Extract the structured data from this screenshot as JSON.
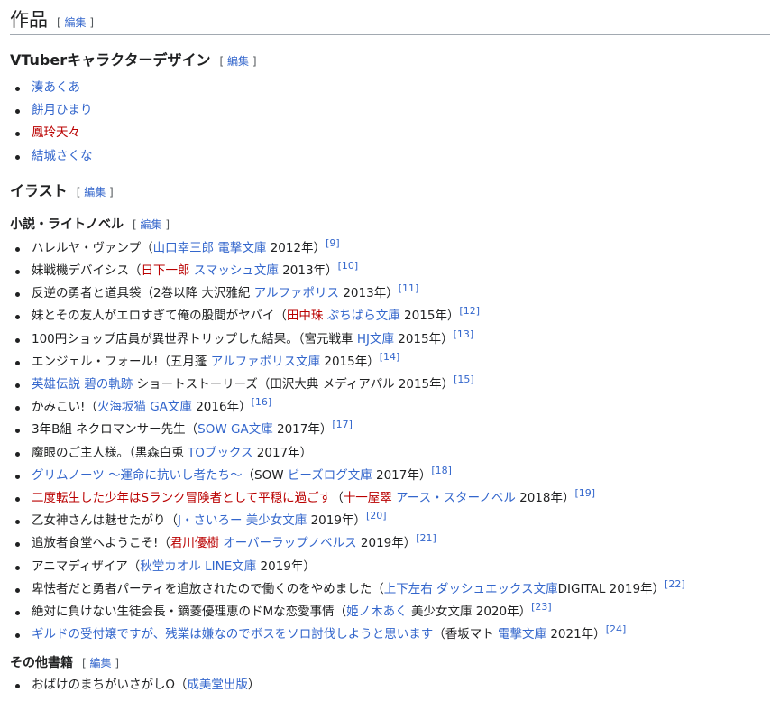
{
  "section_title": "作品",
  "edit_label": "編集",
  "vtuber": {
    "title": "VTuberキャラクターデザイン",
    "items": [
      "湊あくあ",
      "餅月ひまり",
      "鳳玲天々",
      "結城さくな"
    ]
  },
  "illust": {
    "title": "イラスト",
    "novel": {
      "title": "小説・ライトノベル"
    },
    "other": {
      "title": "その他書籍"
    }
  },
  "novels": [
    [
      [
        "ハレルヤ・ヴァンプ（",
        ""
      ],
      [
        "山口幸三郎",
        "b"
      ],
      [
        " ",
        ""
      ],
      [
        "電撃文庫",
        "b"
      ],
      [
        " 2012年）",
        ""
      ],
      [
        "[9]",
        "s"
      ]
    ],
    [
      [
        "妹戦機デバイシス（",
        ""
      ],
      [
        "日下一郎",
        "r"
      ],
      [
        " ",
        ""
      ],
      [
        "スマッシュ文庫",
        "b"
      ],
      [
        " 2013年）",
        ""
      ],
      [
        "[10]",
        "s"
      ]
    ],
    [
      [
        "反逆の勇者と道具袋（2巻以降 大沢雅紀 ",
        ""
      ],
      [
        "アルファポリス",
        "b"
      ],
      [
        " 2013年）",
        ""
      ],
      [
        "[11]",
        "s"
      ]
    ],
    [
      [
        "妹とその友人がエロすぎて俺の股間がヤバイ（",
        ""
      ],
      [
        "田中珠",
        "r"
      ],
      [
        " ",
        ""
      ],
      [
        "ぷちぱら文庫",
        "b"
      ],
      [
        " 2015年）",
        ""
      ],
      [
        "[12]",
        "s"
      ]
    ],
    [
      [
        "100円ショップ店員が異世界トリップした結果。（宮元戦車 ",
        ""
      ],
      [
        "HJ文庫",
        "b"
      ],
      [
        " 2015年）",
        ""
      ],
      [
        "[13]",
        "s"
      ]
    ],
    [
      [
        "エンジェル・フォール!（五月蓬 ",
        ""
      ],
      [
        "アルファポリス文庫",
        "b"
      ],
      [
        " 2015年）",
        ""
      ],
      [
        "[14]",
        "s"
      ]
    ],
    [
      [
        "英雄伝説 碧の軌跡",
        "b"
      ],
      [
        " ショートストーリーズ（田沢大典 メディアパル 2015年）",
        ""
      ],
      [
        "[15]",
        "s"
      ]
    ],
    [
      [
        "かみこい!（",
        ""
      ],
      [
        "火海坂猫",
        "b"
      ],
      [
        " ",
        ""
      ],
      [
        "GA文庫",
        "b"
      ],
      [
        " 2016年）",
        ""
      ],
      [
        "[16]",
        "s"
      ]
    ],
    [
      [
        "3年B組 ネクロマンサー先生（",
        ""
      ],
      [
        "SOW",
        "b"
      ],
      [
        " ",
        ""
      ],
      [
        "GA文庫",
        "b"
      ],
      [
        " 2017年）",
        ""
      ],
      [
        "[17]",
        "s"
      ]
    ],
    [
      [
        "魔眼のご主人様。（黒森白兎 ",
        ""
      ],
      [
        "TOブックス",
        "b"
      ],
      [
        " 2017年）",
        ""
      ]
    ],
    [
      [
        "グリムノーツ 〜運命に抗いし者たち〜",
        "b"
      ],
      [
        "（SOW ",
        ""
      ],
      [
        "ビーズログ文庫",
        "b"
      ],
      [
        " 2017年）",
        ""
      ],
      [
        "[18]",
        "s"
      ]
    ],
    [
      [
        "二度転生した少年はSランク冒険者として平穏に過ごす",
        "r"
      ],
      [
        "（",
        ""
      ],
      [
        "十一屋翠",
        "r"
      ],
      [
        " ",
        ""
      ],
      [
        "アース・スターノベル",
        "b"
      ],
      [
        " 2018年）",
        ""
      ],
      [
        "[19]",
        "s"
      ]
    ],
    [
      [
        "乙女神さんは魅せたがり（",
        ""
      ],
      [
        "J・さいろー",
        "b"
      ],
      [
        " ",
        ""
      ],
      [
        "美少女文庫",
        "b"
      ],
      [
        " 2019年）",
        ""
      ],
      [
        "[20]",
        "s"
      ]
    ],
    [
      [
        "追放者食堂へようこそ!（",
        ""
      ],
      [
        "君川優樹",
        "r"
      ],
      [
        " ",
        ""
      ],
      [
        "オーバーラップノベルス",
        "b"
      ],
      [
        " 2019年）",
        ""
      ],
      [
        "[21]",
        "s"
      ]
    ],
    [
      [
        "アニマディザイア（",
        ""
      ],
      [
        "秋堂カオル",
        "b"
      ],
      [
        " ",
        ""
      ],
      [
        "LINE文庫",
        "b"
      ],
      [
        " 2019年）",
        ""
      ]
    ],
    [
      [
        "卑怯者だと勇者パーティを追放されたので働くのをやめました（",
        ""
      ],
      [
        "上下左右",
        "b"
      ],
      [
        " ",
        ""
      ],
      [
        "ダッシュエックス文庫",
        "b"
      ],
      [
        "DIGITAL 2019年）",
        ""
      ],
      [
        "[22]",
        "s"
      ]
    ],
    [
      [
        "絶対に負けない生徒会長・鏑菱優理恵のドMな恋愛事情（",
        ""
      ],
      [
        "姫ノ木あく",
        "b"
      ],
      [
        " 美少女文庫 2020年）",
        ""
      ],
      [
        "[23]",
        "s"
      ]
    ],
    [
      [
        "ギルドの受付嬢ですが、残業は嫌なのでボスをソロ討伐しようと思います",
        "b"
      ],
      [
        "（香坂マト ",
        ""
      ],
      [
        "電撃文庫",
        "b"
      ],
      [
        " 2021年）",
        ""
      ],
      [
        "[24]",
        "s"
      ]
    ]
  ],
  "other_books": [
    [
      [
        "おばけのまちがいさがしΩ（",
        ""
      ],
      [
        "成美堂出版",
        "b"
      ],
      [
        "）",
        ""
      ]
    ]
  ],
  "colors": {
    "link": "#3366cc",
    "redlink": "#ba0000",
    "text": "#202122"
  }
}
